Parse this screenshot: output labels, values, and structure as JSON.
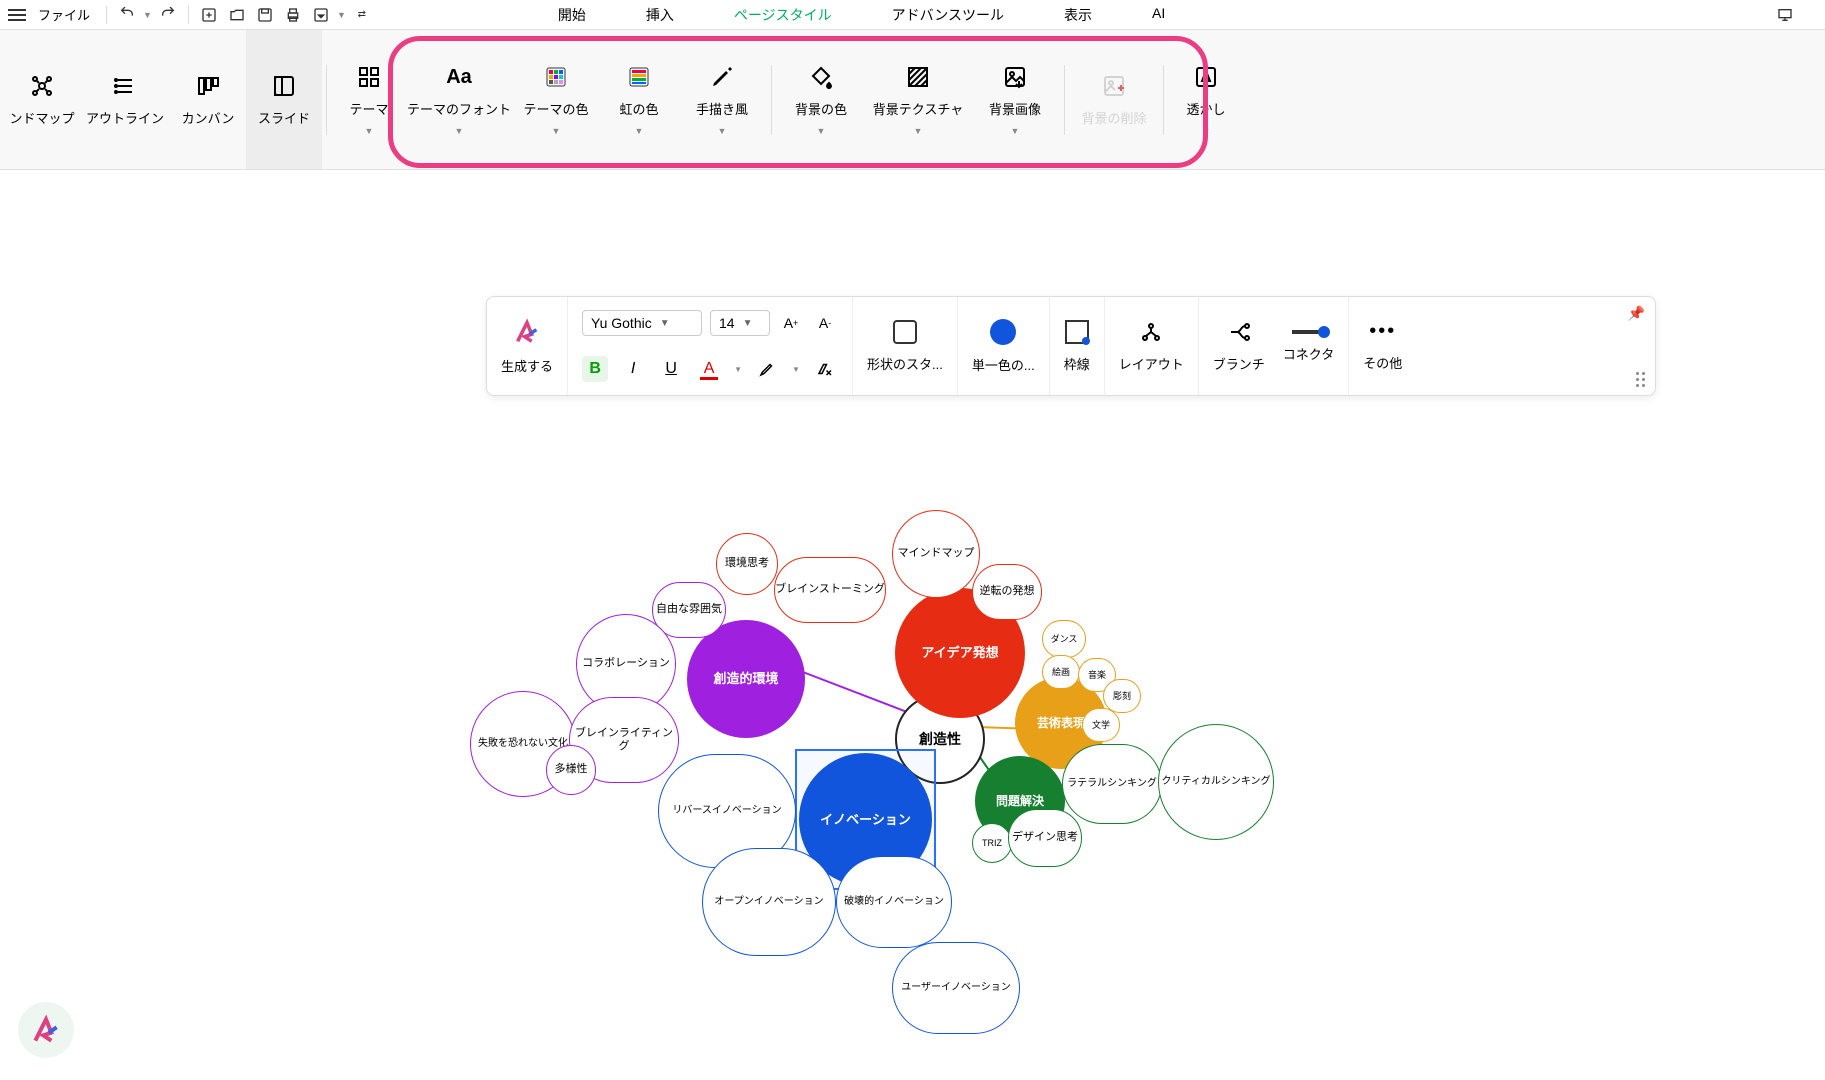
{
  "menubar": {
    "file": "ファイル",
    "tabs": [
      "開始",
      "挿入",
      "ページスタイル",
      "アドバンスツール",
      "表示",
      "AI"
    ],
    "active_tab": 2
  },
  "ribbon": {
    "view_modes": [
      {
        "label": "ンドマップ",
        "icon": "mindmap"
      },
      {
        "label": "アウトライン",
        "icon": "outline"
      },
      {
        "label": "カンバン",
        "icon": "kanban"
      },
      {
        "label": "スライド",
        "icon": "slide"
      }
    ],
    "style_buttons": [
      {
        "label": "テーマ",
        "icon": "theme-grid"
      },
      {
        "label": "テーマのフォント",
        "icon": "font-aa"
      },
      {
        "label": "テーマの色",
        "icon": "palette"
      },
      {
        "label": "虹の色",
        "icon": "rainbow"
      },
      {
        "label": "手描き風",
        "icon": "pencil"
      }
    ],
    "bg_buttons": [
      {
        "label": "背景の色",
        "icon": "fill"
      },
      {
        "label": "背景テクスチャ",
        "icon": "texture"
      },
      {
        "label": "背景画像",
        "icon": "image"
      }
    ],
    "remove_bg": "背景の削除",
    "watermark": "透かし"
  },
  "toolbar": {
    "generate": "生成する",
    "font_name": "Yu Gothic",
    "font_size": "14",
    "shape_style": "形状のスタ...",
    "single_color": "単一色の...",
    "border": "枠線",
    "layout": "レイアウト",
    "branch": "ブランチ",
    "connector": "コネクタ",
    "more": "その他"
  },
  "nodes": {
    "center": "創造性",
    "idea": "アイデア発想",
    "creative_env": "創造的環境",
    "art": "芸術表現",
    "innovation": "イノベーション",
    "problem": "問題解決",
    "n01": "環境思考",
    "n02": "マインドマップ",
    "n03": "ブレインストーミング",
    "n04": "逆転の発想",
    "n05": "自由な雰囲気",
    "n06": "コラボレーション",
    "n07": "失敗を恐れない文化",
    "n08": "ブレインライティング",
    "n09": "多様性",
    "n10": "リバースイノベーション",
    "n11": "オープンイノベーション",
    "n12": "破壊的イノベーション",
    "n13": "ユーザーイノベーション",
    "n14": "TRIZ",
    "n15": "デザイン思考",
    "n16": "ラテラルシンキング",
    "n17": "クリティカルシンキング",
    "n18": "ダンス",
    "n19": "絵画",
    "n20": "音楽",
    "n21": "彫刻",
    "n22": "文学"
  }
}
